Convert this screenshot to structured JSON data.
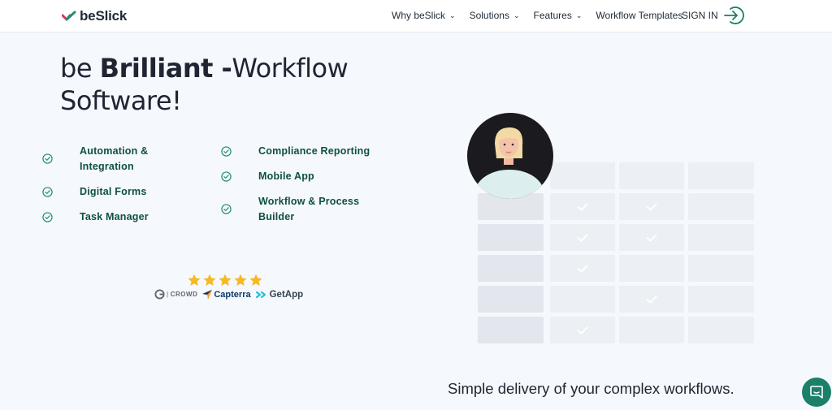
{
  "header": {
    "logo_text": "beSlick",
    "nav": [
      {
        "label": "Why beSlick",
        "has_dropdown": true
      },
      {
        "label": "Solutions",
        "has_dropdown": true
      },
      {
        "label": "Features",
        "has_dropdown": true
      },
      {
        "label": "Workflow Templates",
        "has_dropdown": false
      }
    ],
    "signin_label": "SIGN IN"
  },
  "hero": {
    "headline_pre": "be ",
    "headline_bold": "Brilliant -",
    "headline_post": "Workflow Software!",
    "features_left": [
      {
        "line1": "Automation &",
        "line2": "Integration"
      },
      {
        "line1": "Digital Forms",
        "line2": ""
      },
      {
        "line1": "Task Manager",
        "line2": ""
      }
    ],
    "features_right": [
      {
        "line1": "Compliance Reporting",
        "line2": ""
      },
      {
        "line1": "Mobile App",
        "line2": ""
      },
      {
        "line1": "Workflow & Process",
        "line2": "Builder"
      }
    ]
  },
  "rating": {
    "stars": 5,
    "star_color": "#f5b921",
    "crowd_label": "CROWD",
    "capterra_label": "Capterra",
    "getapp_label": "GetApp"
  },
  "tagline": "Simple delivery of your complex workflows.",
  "colors": {
    "brand_green": "#0e4f46",
    "check_green": "#1f8f72",
    "chat_button": "#1b7f6a"
  },
  "icons": {
    "feature_check": "check-circle-icon",
    "signin": "sign-in-arrow-icon",
    "chat": "chat-bubble-icon"
  }
}
